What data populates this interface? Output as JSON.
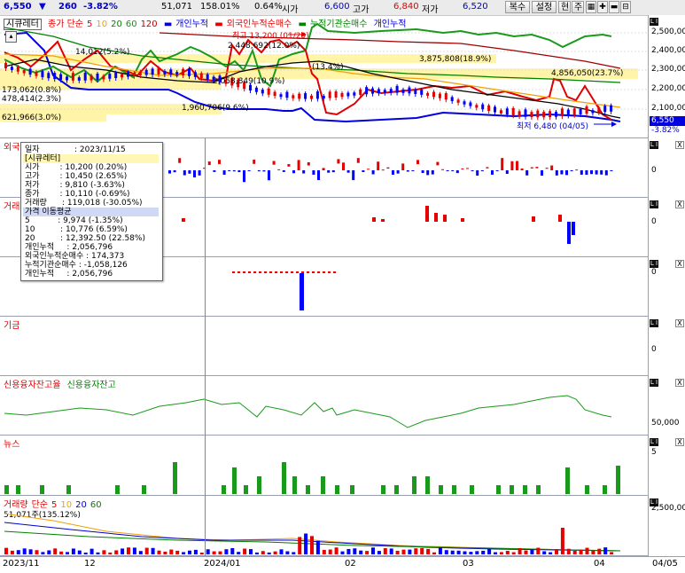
{
  "header": {
    "price": "6,550",
    "arrow": "▼",
    "change": "260",
    "change_pct": "-3.82%",
    "volume": "51,071",
    "volume_ratio": "158.01%",
    "turnover_pct": "0.64%",
    "open_label": "시가",
    "open": "6,600",
    "high_label": "고가",
    "high": "6,840",
    "low_label": "저가",
    "low": "6,520",
    "buttons": [
      "복수",
      "설정",
      "현",
      "주"
    ]
  },
  "main_panel": {
    "legend": {
      "name": "시큐레터",
      "ma_label": "종가 단순",
      "ma5": "5",
      "ma10": "10",
      "ma20": "20",
      "ma60": "60",
      "ma120": "120",
      "s1": "개인누적",
      "s2": "외국인누적순매수",
      "s3": "누적기관순매수",
      "s4": "개인누적"
    },
    "annotations": {
      "high": "최고 13,200 (01/29)",
      "low": "최저 6,480 (04/05)",
      "a1": "14,012(5.2%)",
      "a2": "2,448,692(12.0%)",
      "a3": "3,875,808(18.9%)",
      "a4": "4,856,050(23.7%)",
      "a5": "2,058,849(10.9%)",
      "a6": "1,960,706(9.6%)",
      "a7": "173,062(0.8%)",
      "a8": "478,414(2.3%)",
      "a9": "621,966(3.0%)",
      "a10": "(13.4%)"
    },
    "yticks": [
      "2,500,000",
      "2,400,000",
      "2,300,000",
      "2,200,000",
      "2,100,000"
    ],
    "price_tag": "6,550",
    "price_pct": "-3.82%"
  },
  "tooltip": {
    "date_label": "일자",
    "date": ": 2023/11/15",
    "name": "[시큐레터]",
    "open": "시가        : 10,200 (0.20%)",
    "high": "고가        : 10,450 (2.65%)",
    "low": "저가        : 9,810 (-3.63%)",
    "close": "종가        : 10,110 (-0.69%)",
    "volume": "거래량      : 119,018 (-30.05%)",
    "ma_header": "가격 이동평균",
    "ma5": "5           : 9,974 (-1.35%)",
    "ma10": "10          : 10,776 (6.59%)",
    "ma20": "20          : 12,392.50 (22.58%)",
    "indiv": "개인누적     : 2,056,796",
    "foreign": "외국인누적순매수 : 174,373",
    "inst": "누적기관순매수 : -1,058,126",
    "indiv2": "개인누적     : 2,056,796"
  },
  "panels": {
    "p2_title": "외국인순매수",
    "p2_zero": "0",
    "p3_title": "거래량",
    "p3_zero": "0",
    "p4_title": "",
    "p4_zero": "0",
    "p5_title": "기금",
    "p5_zero": "0",
    "p6_title1": "신용융자잔고율",
    "p6_title2": "신용융자잔고",
    "p6_tick": "50,000",
    "p7_title": "뉴스",
    "p7_tick": "5",
    "p8_title": "거래량",
    "p8_ma_label": "단순",
    "p8_ma5": "5",
    "p8_ma10": "10",
    "p8_ma20": "20",
    "p8_ma60": "60",
    "p8_value": "51,071주(135.12%)",
    "p8_tick": "2,500,00"
  },
  "xaxis": {
    "labels": [
      "2023/11",
      "12",
      "2024/01",
      "02",
      "03",
      "04",
      "04/05"
    ]
  },
  "colors": {
    "up": "#e60000",
    "down": "#0000ff",
    "ma5": "#e60000",
    "ma10": "#f0a000",
    "ma20": "#008000",
    "ma60": "#009000",
    "ma120": "#c00000",
    "highlight": "#fff4a8"
  },
  "icons": [
    "settings-grid-icon",
    "add-icon",
    "remove-icon",
    "window-icon",
    "link-icon",
    "close-icon"
  ]
}
